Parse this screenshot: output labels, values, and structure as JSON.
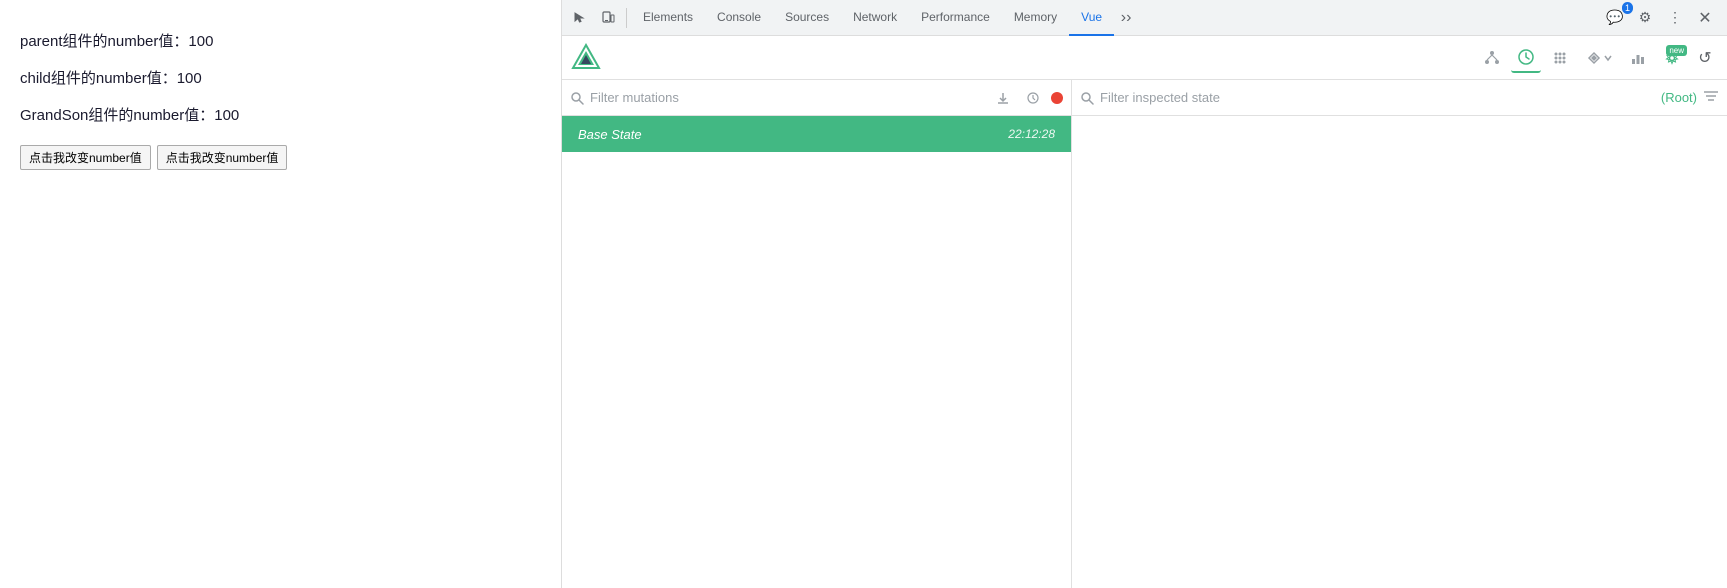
{
  "page": {
    "parent_text": "parent组件的number值：100",
    "child_text": "child组件的number值：100",
    "grandson_text": "GrandSon组件的number值：100",
    "btn1_label": "点击我改变number值",
    "btn2_label": "点击我改变number值"
  },
  "devtools": {
    "tabs": [
      {
        "label": "Elements",
        "active": false
      },
      {
        "label": "Console",
        "active": false
      },
      {
        "label": "Sources",
        "active": false
      },
      {
        "label": "Network",
        "active": false
      },
      {
        "label": "Performance",
        "active": false
      },
      {
        "label": "Memory",
        "active": false
      },
      {
        "label": "Vue",
        "active": true
      }
    ],
    "chat_count": "1",
    "more_label": "⋮"
  },
  "vue": {
    "toolbar": {
      "component_icon": "⎈",
      "timeline_icon": "⏱",
      "grid_icon": "⊞",
      "route_icon": "◈",
      "chart_icon": "📊",
      "settings_icon": "⚙",
      "refresh_icon": "↺"
    },
    "mutations_panel": {
      "search_placeholder": "Filter mutations",
      "download_icon": "⬇",
      "clock_icon": "⊙",
      "record_label": "record"
    },
    "state_panel": {
      "search_placeholder": "Filter inspected state",
      "root_label": "(Root)",
      "filter_icon": "≡"
    },
    "mutation_item": {
      "name": "Base State",
      "time": "22:12:28"
    }
  }
}
